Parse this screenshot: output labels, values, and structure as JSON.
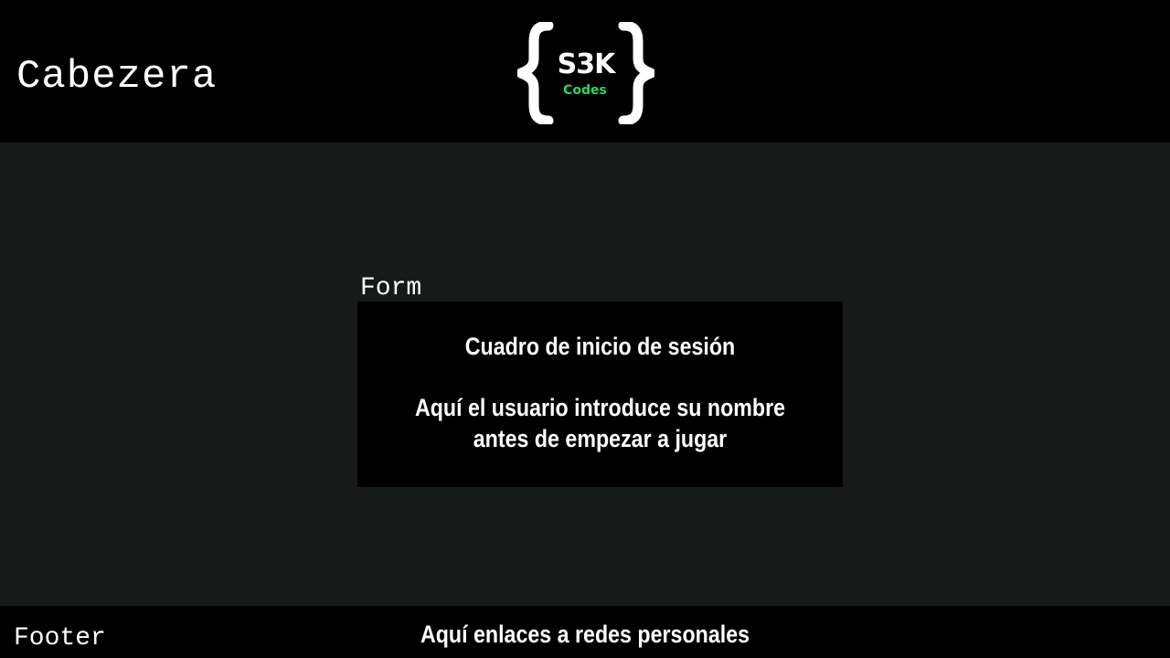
{
  "header": {
    "label": "Cabezera",
    "logo": {
      "icon": "curly-braces-logo",
      "title": "S3K",
      "subtitle": "Codes",
      "subtitle_color": "#2bd468"
    }
  },
  "form": {
    "label": "Form",
    "box_title": "Cuadro de inicio de sesión",
    "box_description": "Aquí el usuario introduce su nombre antes de empezar a jugar"
  },
  "footer": {
    "label": "Footer",
    "text": "Aquí enlaces a redes personales"
  },
  "colors": {
    "page_background": "#161b1a",
    "panel_background": "#000000",
    "text": "#ffffff"
  }
}
